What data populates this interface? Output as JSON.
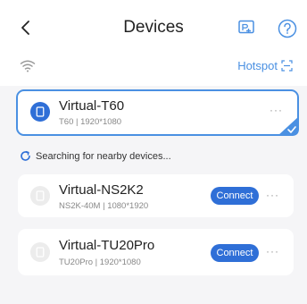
{
  "header": {
    "title": "Devices",
    "back_icon": "chevron-left-icon",
    "cast_icon": "screen-cast-icon",
    "help_icon": "question-circle-icon"
  },
  "network": {
    "wifi_icon": "wifi-icon",
    "hotspot_label": "Hotspot",
    "hotspot_icon": "scan-icon"
  },
  "connected_device": {
    "name": "Virtual-T60",
    "model": "T60",
    "resolution": "1920*1080",
    "detail": "T60  |  1920*1080",
    "more": "···",
    "selected": true
  },
  "search_status": "Searching for nearby devices...",
  "nearby_devices": [
    {
      "name": "Virtual-NS2K2",
      "detail": "NS2K-40M  |  1080*1920",
      "action": "Connect",
      "more": "···"
    },
    {
      "name": "Virtual-TU20Pro",
      "detail": "TU20Pro  |  1920*1080",
      "action": "Connect",
      "more": "···"
    }
  ],
  "colors": {
    "accent": "#2f6fd7",
    "link": "#4a90e2",
    "background": "#f5f5f7"
  }
}
